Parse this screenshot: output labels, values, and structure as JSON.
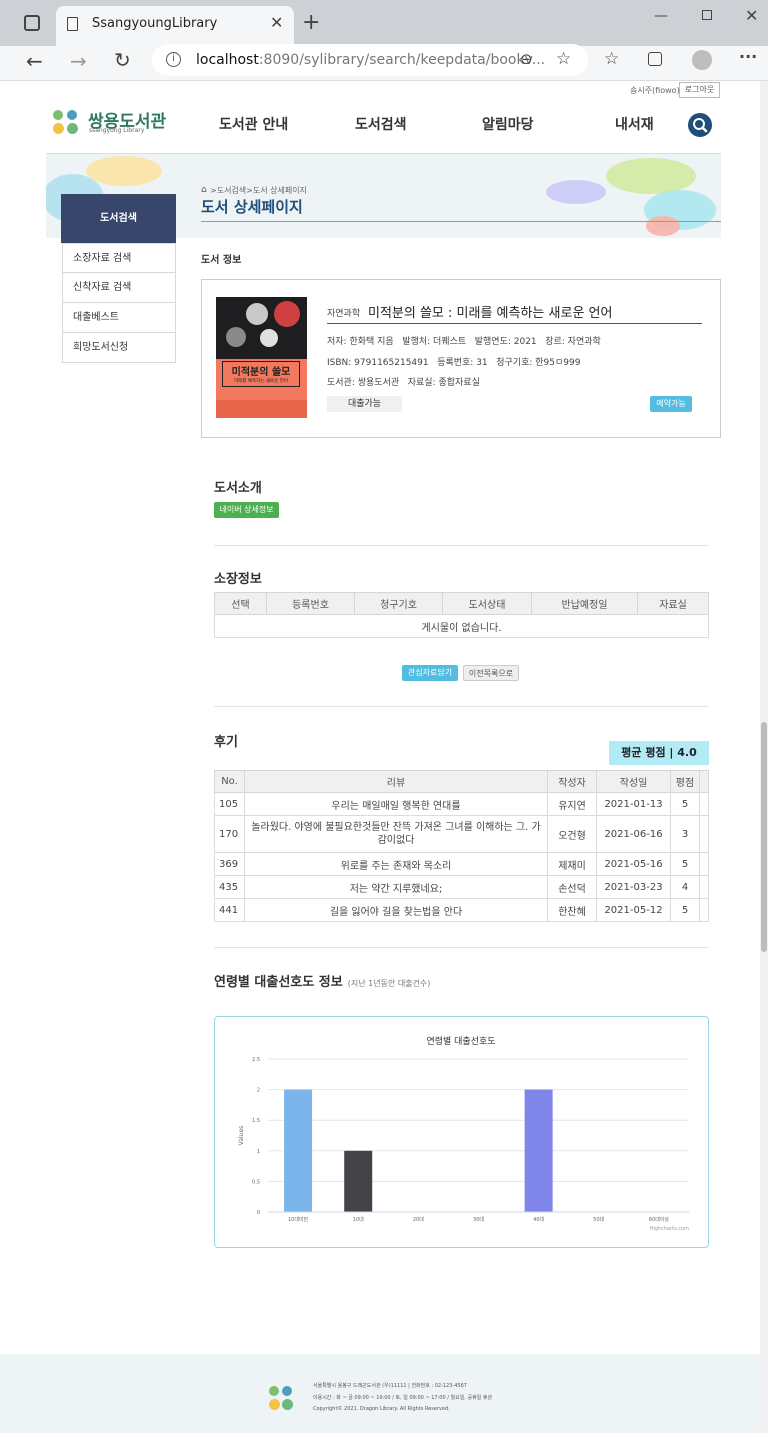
{
  "browser": {
    "tab_title": "SsangyoungLibrary",
    "url_host": "localhost",
    "url_rest": ":8090/sylibrary/search/keepdata/bookv..."
  },
  "header": {
    "logo_main": "쌍용도서관",
    "logo_sub": "ssangyong Library",
    "user": "송시주(fiowo)",
    "logout": "로그아웃",
    "nav": [
      "도서관 안내",
      "도서검색",
      "알림마당",
      "내서재"
    ]
  },
  "banner": {
    "breadcrumb": ">도서검색>도서 상세페이지",
    "title": "도서 상세페이지"
  },
  "sidebar": {
    "heading": "도서검색",
    "items": [
      "소장자료 검색",
      "신착자료 검색",
      "대출베스트",
      "희망도서신청"
    ]
  },
  "bookinfo": {
    "section": "도서 정보",
    "cover_title": "미적분의 쓸모",
    "cover_sub": "미래를 예측하는 새로운 언어",
    "category": "자연과학",
    "title": "미적분의 쓸모 : 미래를 예측하는 새로운 언어",
    "line1": "저자: 한화택 지음   발행처: 더퀘스트   발행연도: 2021   장르: 자연과학",
    "line2": "ISBN: 9791165215491   등록번호: 31   청구기호: 한95ㅁ999",
    "line3": "도서관: 쌍용도서관   자료실: 종합자료실",
    "loan_status": "대출가능",
    "reserve": "예약가능"
  },
  "intro": {
    "title": "도서소개",
    "naver": "네이버 상세정보"
  },
  "holdings": {
    "title": "소장정보",
    "headers": [
      "선택",
      "등록번호",
      "청구기호",
      "도서상태",
      "반납예정일",
      "자료실"
    ],
    "empty": "게시물이 없습니다.",
    "btn_interest": "관심자료담기",
    "btn_back": "이전목록으로"
  },
  "reviews": {
    "title": "후기",
    "avg": "평균 평점 | 4.0",
    "headers": [
      "No.",
      "리뷰",
      "작성자",
      "작성일",
      "평점"
    ],
    "rows": [
      {
        "no": "105",
        "text": "우리는 매일매일 행복한 연대를",
        "writer": "유지연",
        "date": "2021-01-13",
        "score": "5"
      },
      {
        "no": "170",
        "text": "놀라웠다. 야영에 불필요한것들만 잔뜩 가져온 그녀를 이해하는 그. 가감이없다",
        "writer": "오건형",
        "date": "2021-06-16",
        "score": "3"
      },
      {
        "no": "369",
        "text": "위로를 주는 존재와 목소리",
        "writer": "제재미",
        "date": "2021-05-16",
        "score": "5"
      },
      {
        "no": "435",
        "text": "저는 약간 지루했네요;",
        "writer": "손선덕",
        "date": "2021-03-23",
        "score": "4"
      },
      {
        "no": "441",
        "text": "길을 잃어야 길을 찾는법을 안다",
        "writer": "한찬혜",
        "date": "2021-05-12",
        "score": "5"
      }
    ]
  },
  "age_section": {
    "title": "연령별 대출선호도 정보",
    "note": "(지난 1년동안 대출건수)"
  },
  "chart_data": {
    "type": "bar",
    "title": "연령별 대출선호도",
    "ylabel": "Values",
    "xlabel": "",
    "categories": [
      "10대미만",
      "10대",
      "20대",
      "30대",
      "40대",
      "50대",
      "60대이상"
    ],
    "values": [
      2,
      1,
      0,
      0,
      2,
      0,
      0
    ],
    "colors": [
      "#7cb5ec",
      "#434348",
      "#90ed7d",
      "#f7a35c",
      "#8085e9",
      "#f15c80",
      "#e4d354"
    ],
    "ylim": [
      0,
      2.5
    ],
    "yticks": [
      "0",
      "0.5",
      "1",
      "1.5",
      "2",
      "2.5"
    ],
    "credits": "Highcharts.com",
    "grid": true
  },
  "footer": {
    "line1": "서울특별시 용봉구 드래곤도서관 (우)11111 | 전화번호 : 02-123-4567",
    "line2": "이용시간 : 화 ~ 금 09:00 ~ 19:00 / 토, 일 09:00 ~ 17:00 / 월요일, 공휴일 휴관",
    "line3": "Copyright© 2021. Dragon Library. All Rights Reserved."
  }
}
